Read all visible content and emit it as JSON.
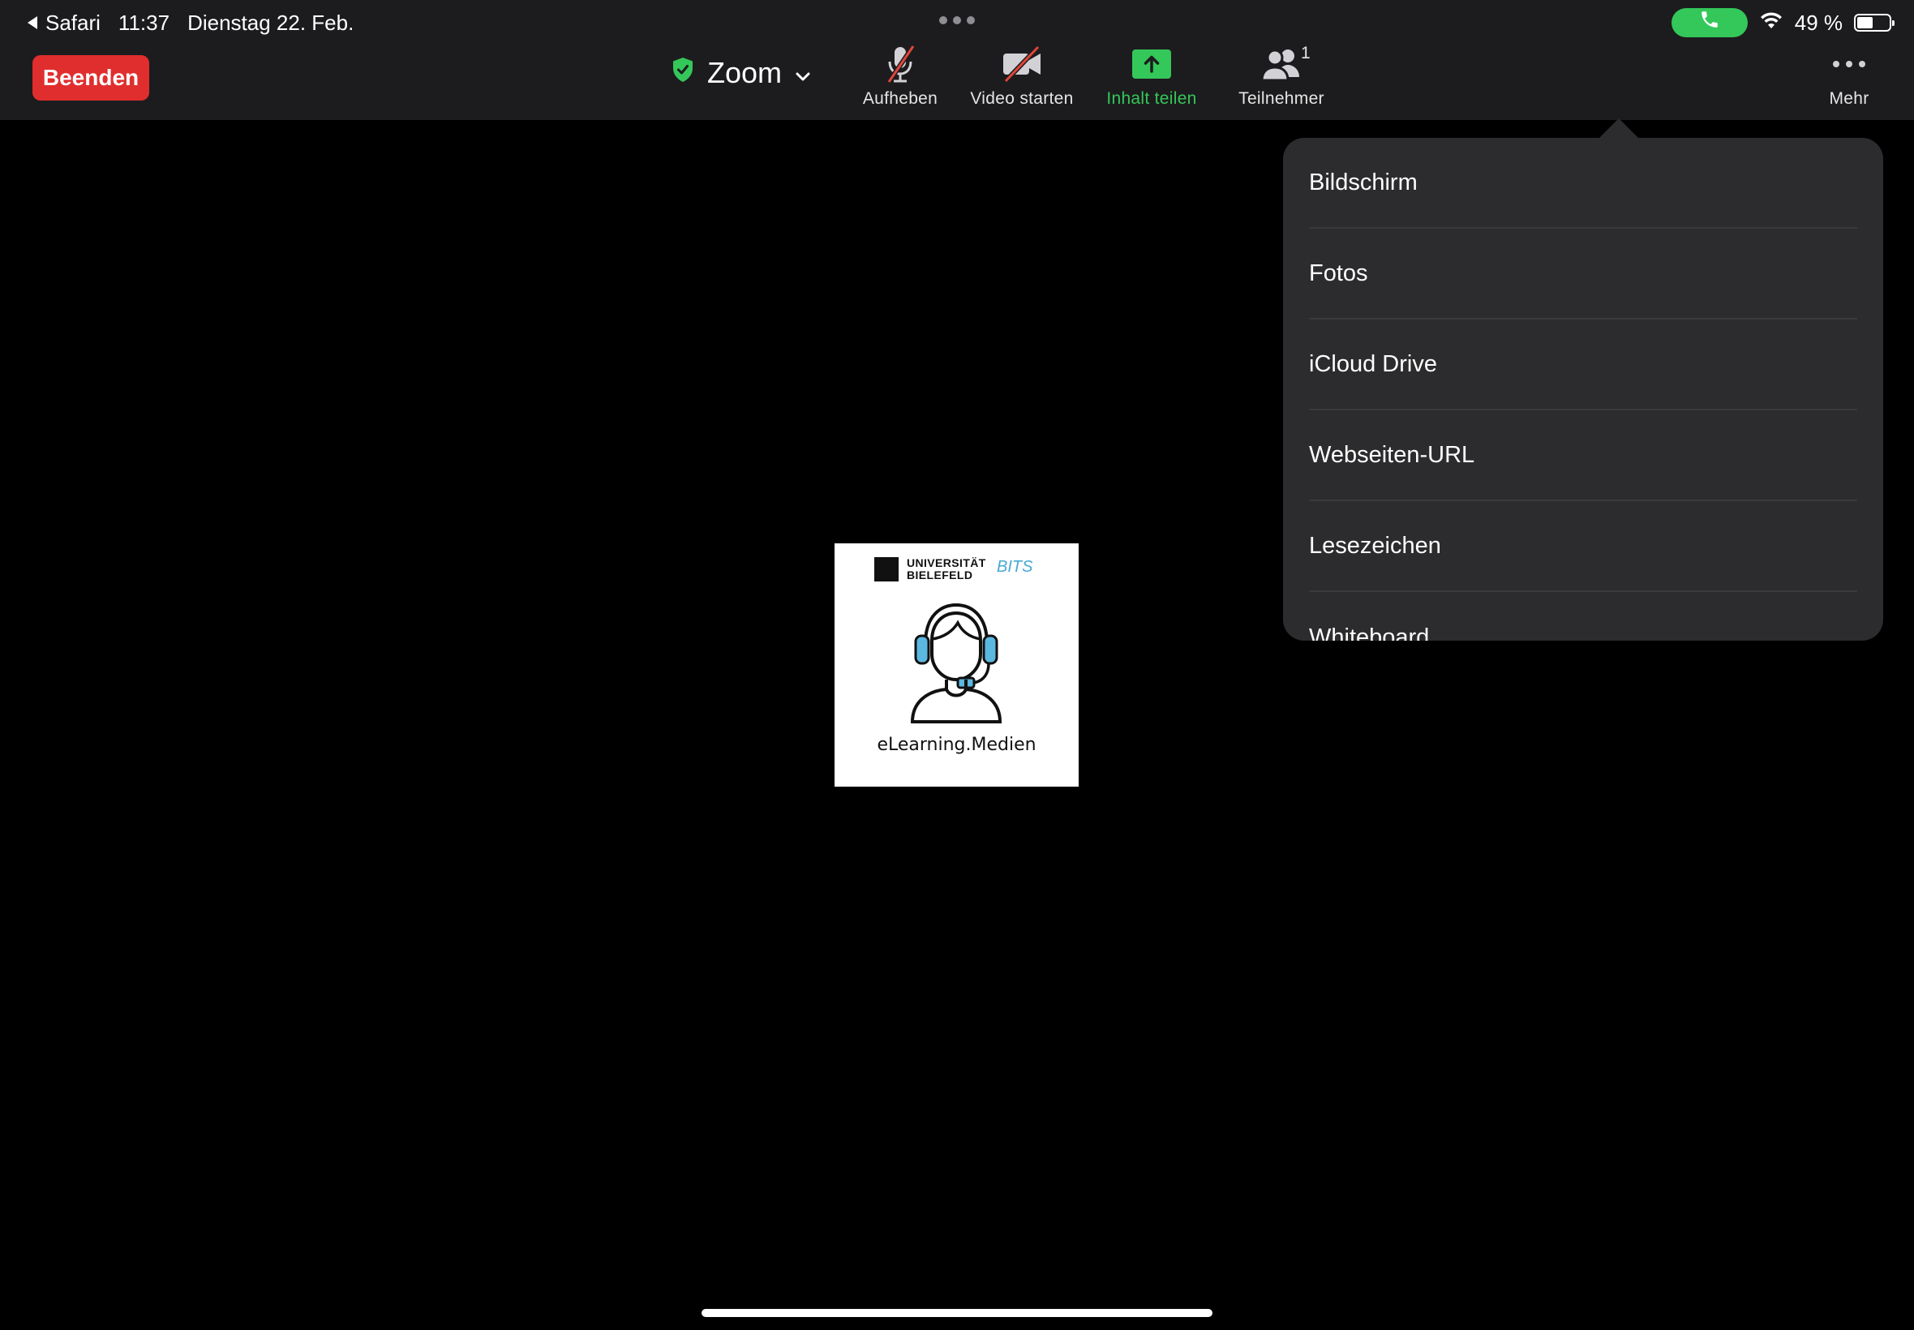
{
  "status_bar": {
    "back_app": "Safari",
    "time": "11:37",
    "date": "Dienstag 22. Feb.",
    "battery": "49 %",
    "battery_level": 0.49
  },
  "toolbar": {
    "end_button": "Beenden",
    "meeting_title": "Zoom",
    "tools": {
      "mute": "Aufheben",
      "video": "Video starten",
      "share": "Inhalt teilen",
      "participants": "Teilnehmer",
      "participants_count": "1",
      "more": "Mehr"
    }
  },
  "video_tile": {
    "university": [
      "UNIVERSITÄT",
      "BIELEFELD"
    ],
    "partner_logo": "BITS",
    "caption": "eLearning.Medien"
  },
  "share_menu": {
    "items": [
      "Bildschirm",
      "Fotos",
      "iCloud Drive",
      "Webseiten-URL",
      "Lesezeichen",
      "Whiteboard"
    ]
  },
  "colors": {
    "accent_green": "#34c759",
    "end_red": "#e02e2e",
    "toolbar_bg": "#1c1c1e",
    "popover_bg": "#2c2c2e",
    "mute_slash": "#e0453a"
  },
  "icons": [
    "back-arrow-icon",
    "multitasking-dots-icon",
    "phone-icon",
    "wifi-icon",
    "battery-icon",
    "shield-check-icon",
    "chevron-down-icon",
    "microphone-off-icon",
    "video-off-icon",
    "share-upload-icon",
    "participants-icon",
    "more-dots-icon",
    "headset-person-icon"
  ]
}
